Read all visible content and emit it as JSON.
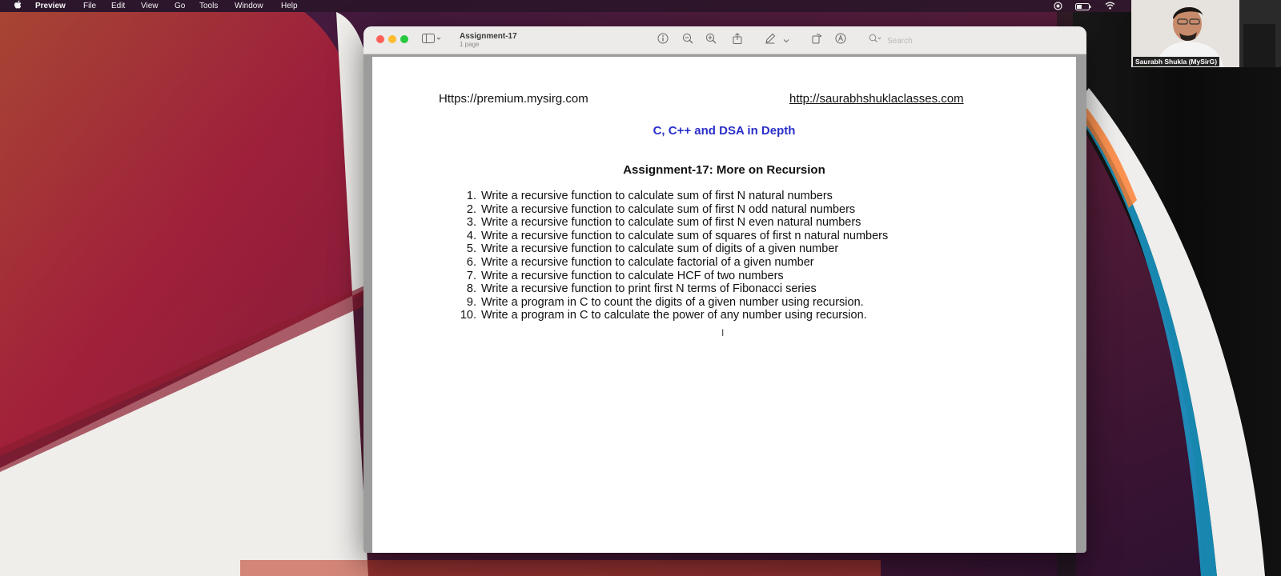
{
  "menubar": {
    "app_name": "Preview",
    "items": [
      "File",
      "Edit",
      "View",
      "Go",
      "Tools",
      "Window",
      "Help"
    ]
  },
  "window": {
    "title": "Assignment-17",
    "subtitle": "1 page",
    "search_placeholder": "Search"
  },
  "document": {
    "header_left": "Https://premium.mysirg.com",
    "header_right": "http://saurabhshuklaclasses.com",
    "course_title": "C, C++ and DSA in Depth",
    "assignment_title": "Assignment-17: More on Recursion",
    "questions": [
      {
        "num": "1.",
        "text": "Write a recursive function to calculate sum of first N natural numbers"
      },
      {
        "num": "2.",
        "text": "Write a recursive function to calculate sum of first N odd natural numbers"
      },
      {
        "num": "3.",
        "text": "Write a recursive function to calculate sum of first N even natural numbers"
      },
      {
        "num": "4.",
        "text": "Write a recursive function to calculate sum of squares of first n natural numbers"
      },
      {
        "num": "5.",
        "text": "Write a recursive function to calculate sum of digits of a given number"
      },
      {
        "num": "6.",
        "text": "Write a recursive function to calculate factorial of a given number"
      },
      {
        "num": "7.",
        "text": "Write a recursive function to calculate HCF of two numbers"
      },
      {
        "num": "8.",
        "text": "Write a recursive function to print first N terms of Fibonacci series"
      },
      {
        "num": "9.",
        "text": "Write a program in C to count the digits of a given number using recursion."
      },
      {
        "num": "10.",
        "text": "Write a program in C to calculate the power of any number using recursion."
      }
    ]
  },
  "webcam": {
    "name_label": "Saurabh Shukla (MySirG)"
  },
  "colors": {
    "course_title": "#2a2fc8",
    "close": "#fe5f57",
    "minimize": "#febc2e",
    "zoom": "#28c840"
  }
}
